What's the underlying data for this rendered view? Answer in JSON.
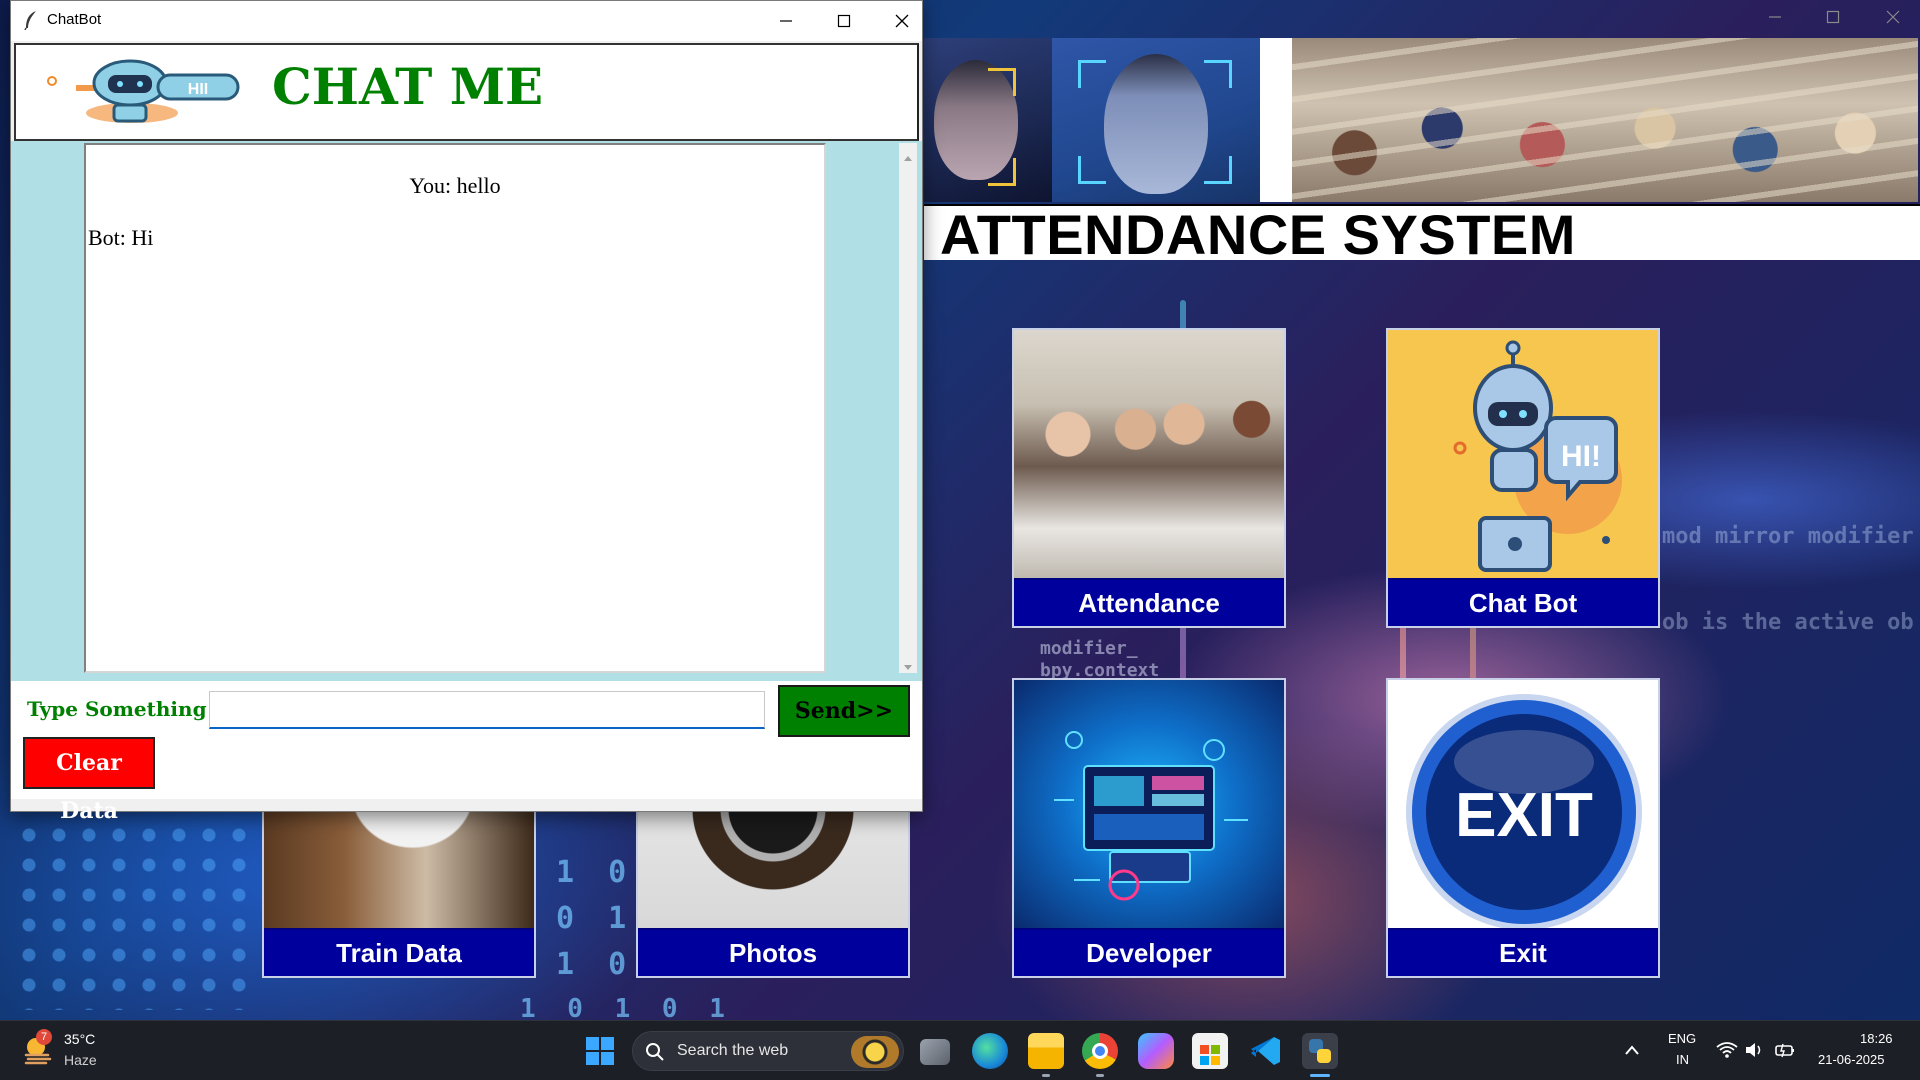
{
  "chatbot_window": {
    "title": "ChatBot",
    "header_title": "CHAT ME",
    "logo_badge": "HII",
    "messages": [
      {
        "sender": "user",
        "text": "You: hello"
      },
      {
        "sender": "bot",
        "text": "Bot: Hi"
      }
    ],
    "input_label": "Type Something",
    "input_value": "",
    "send_label": "Send>>",
    "clear_label": "Clear Data"
  },
  "main_app": {
    "title": "ATTENDANCE SYSTEM",
    "tiles": [
      {
        "label": "Attendance"
      },
      {
        "label": "Chat Bot"
      },
      {
        "label": "Train Data"
      },
      {
        "label": "Photos"
      },
      {
        "label": "Developer"
      },
      {
        "label": "Exit"
      }
    ],
    "chatbot_art_text": "HI!",
    "exit_art_text": "EXIT",
    "background_code_lines": [
      "mod mirror modifier",
      "ob is the active ob",
      "modifier_",
      "bpy.context"
    ],
    "background_binary": [
      "1 0 1",
      "0 1 0",
      "1 0 1",
      "1 0 1 0 1"
    ]
  },
  "taskbar": {
    "weather_temp": "35°C",
    "weather_desc": "Haze",
    "weather_badge": "7",
    "search_placeholder": "Search the web",
    "language": "ENG",
    "region": "IN",
    "time": "18:26",
    "date": "21-06-2025"
  },
  "colors": {
    "chat_title_green": "#008000",
    "chat_body_bg": "#b0e0e6",
    "send_button": "#008000",
    "clear_button": "#ff0000",
    "tile_label_bg": "#00009c",
    "taskbar_bg": "#1c1f26"
  },
  "icons": [
    "feather-icon",
    "minimize-icon",
    "maximize-icon",
    "close-icon",
    "robot-logo",
    "scroll-up-icon",
    "scroll-down-icon",
    "windows-start-icon",
    "search-icon",
    "task-view-icon",
    "edge-icon",
    "file-explorer-icon",
    "chrome-icon",
    "copilot-icon",
    "store-icon",
    "vscode-icon",
    "python-icon",
    "chevron-up-icon",
    "wifi-icon",
    "volume-icon",
    "battery-icon"
  ]
}
